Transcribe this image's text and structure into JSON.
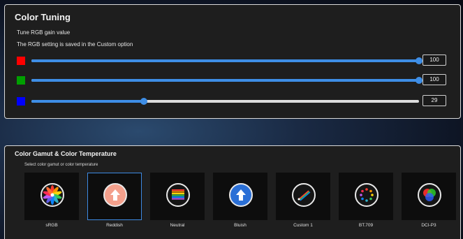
{
  "color_tuning": {
    "title": "Color Tuning",
    "subtitle": "Tune RGB gain value",
    "note": "The RGB setting is saved in the Custom option",
    "channels": [
      {
        "name": "red",
        "color": "#ff0000",
        "value": "100",
        "level": 1.0
      },
      {
        "name": "green",
        "color": "#00a000",
        "value": "100",
        "level": 1.0
      },
      {
        "name": "blue",
        "color": "#0000ff",
        "value": "29",
        "level": 0.29
      }
    ]
  },
  "gamut": {
    "title": "Color Gamut & Color Temperature",
    "subtitle": "Select color gamut or color temperature",
    "selected": "Reddish",
    "presets": [
      {
        "label": "sRGB",
        "icon": "color-wheel-icon"
      },
      {
        "label": "Reddish",
        "icon": "warm-arrow-up-icon",
        "icon_color": "#f4a08c"
      },
      {
        "label": "Neutral",
        "icon": "rainbow-bars-icon"
      },
      {
        "label": "Bluish",
        "icon": "cool-arrow-up-icon",
        "icon_color": "#2a6fd6"
      },
      {
        "label": "Custom 1",
        "icon": "custom-slider-icon"
      },
      {
        "label": "BT.709",
        "icon": "dotted-ring-icon"
      },
      {
        "label": "DCI-P3",
        "icon": "rgb-circles-icon"
      }
    ]
  },
  "colors": {
    "accent": "#3e8ee6",
    "panel": "#1e1e1e",
    "border": "#d9d9d9"
  }
}
